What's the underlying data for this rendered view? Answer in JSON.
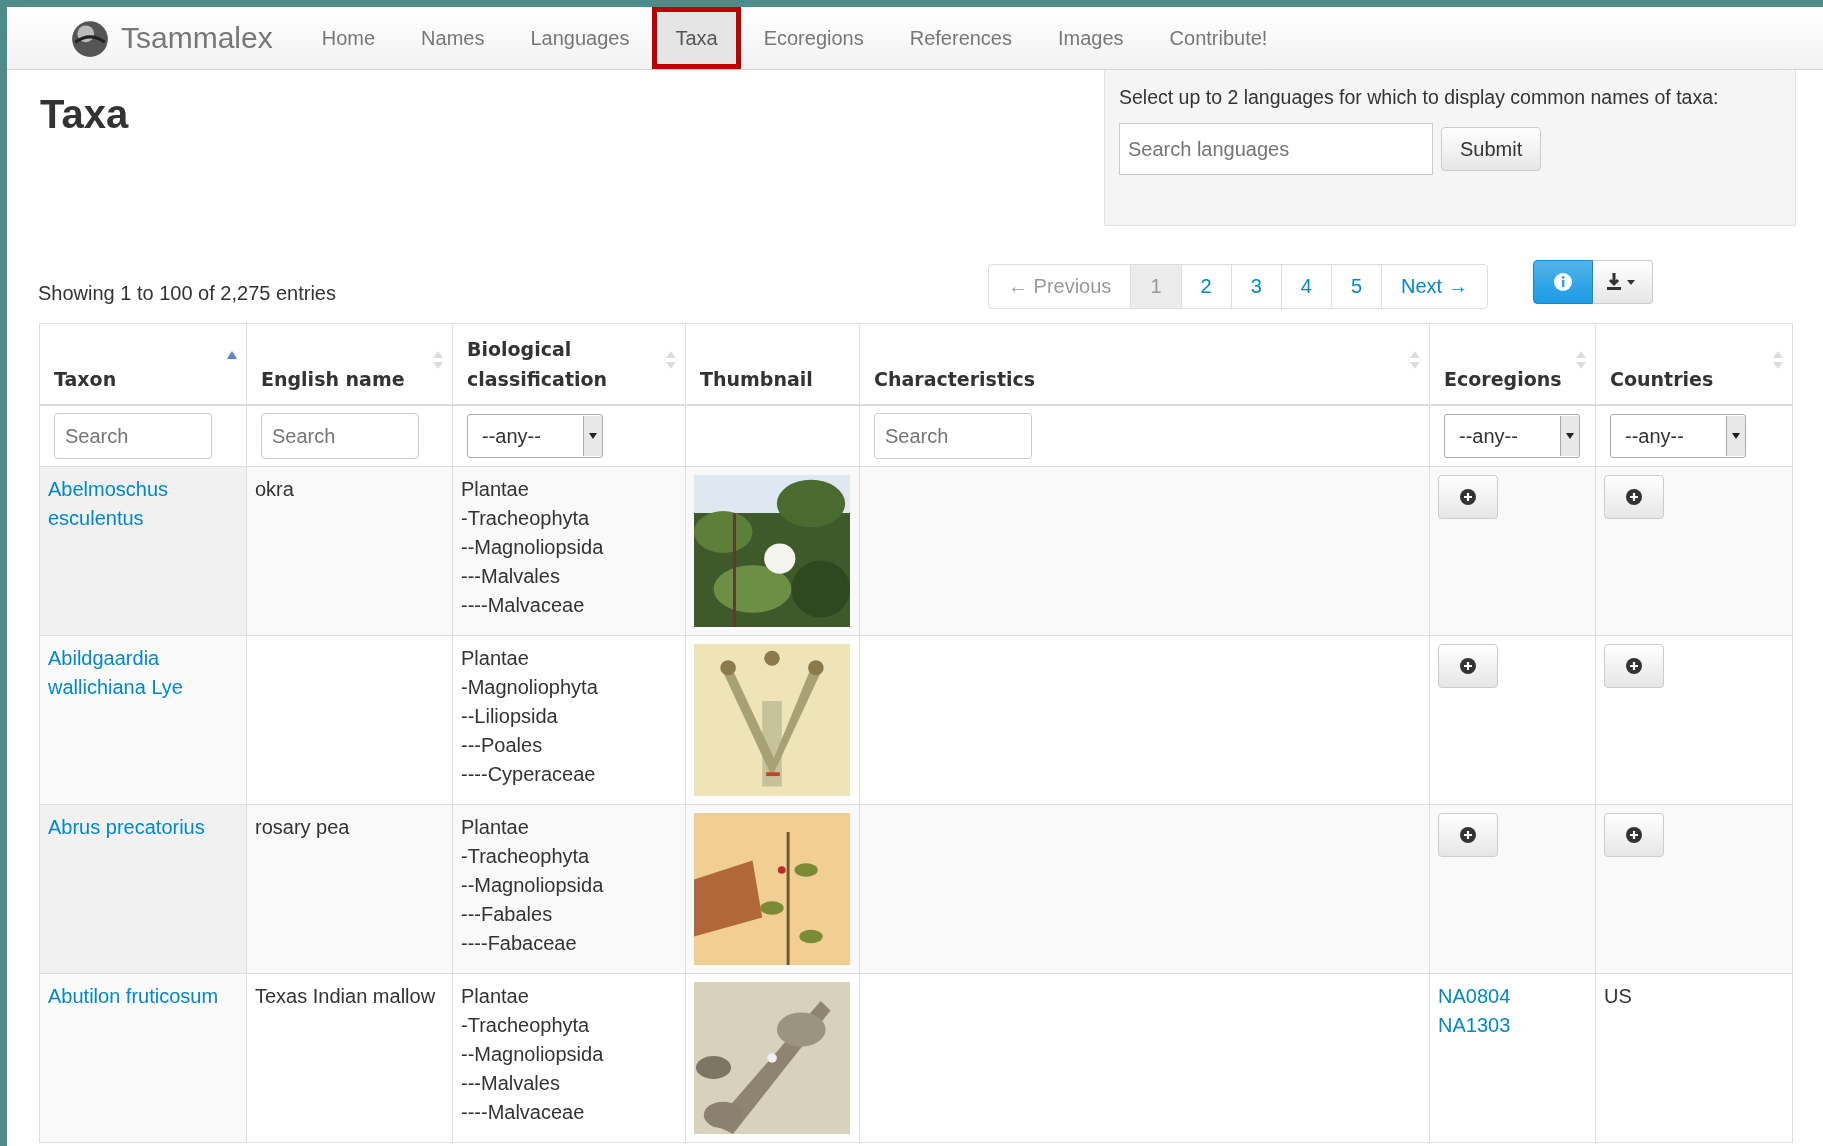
{
  "brand": "Tsammalex",
  "nav": [
    {
      "label": "Home",
      "selected": false
    },
    {
      "label": "Names",
      "selected": false
    },
    {
      "label": "Languages",
      "selected": false
    },
    {
      "label": "Taxa",
      "selected": true
    },
    {
      "label": "Ecoregions",
      "selected": false
    },
    {
      "label": "References",
      "selected": false
    },
    {
      "label": "Images",
      "selected": false
    },
    {
      "label": "Contribute!",
      "selected": false
    }
  ],
  "title": "Taxa",
  "language_panel": {
    "text": "Select up to 2 languages for which to display common names of taxa:",
    "placeholder": "Search languages",
    "button": "Submit"
  },
  "info": "Showing 1 to 100 of 2,275 entries",
  "pagination": [
    {
      "label": "← Previous",
      "selected": false,
      "disabled": true
    },
    {
      "label": "1",
      "selected": true,
      "disabled": false
    },
    {
      "label": "2",
      "selected": false,
      "disabled": false
    },
    {
      "label": "3",
      "selected": false,
      "disabled": false
    },
    {
      "label": "4",
      "selected": false,
      "disabled": false
    },
    {
      "label": "5",
      "selected": false,
      "disabled": false
    },
    {
      "label": "Next →",
      "selected": false,
      "disabled": false
    }
  ],
  "columns": [
    {
      "label": "Taxon",
      "sorted": true,
      "filter": {
        "kind": "search",
        "placeholder": "Search"
      }
    },
    {
      "label": "English name",
      "sorted": false,
      "filter": {
        "kind": "search",
        "placeholder": "Search"
      }
    },
    {
      "label": "Biological classification",
      "sorted": false,
      "filter": {
        "kind": "select",
        "value": "--any--"
      }
    },
    {
      "label": "Thumbnail"
    },
    {
      "label": "Characteristics",
      "sorted": false,
      "filter": {
        "kind": "search",
        "placeholder": "Search"
      }
    },
    {
      "label": "Ecoregions",
      "sorted": false,
      "filter": {
        "kind": "select",
        "value": "--any--"
      }
    },
    {
      "label": "Countries",
      "sorted": false,
      "filter": {
        "kind": "select",
        "value": "--any--"
      }
    }
  ],
  "rows": [
    {
      "taxon": "Abelmoschus esculentus",
      "english": "okra",
      "classification": [
        "Plantae",
        "-Tracheophyta",
        "--Magnoliopsida",
        "---Malvales",
        "----Malvaceae"
      ],
      "ecoregions": {
        "kind": "toggle"
      },
      "countries": {
        "kind": "toggle"
      }
    },
    {
      "taxon": "Abildgaardia wallichiana Lye",
      "classification": [
        "Plantae",
        "-Magnoliophyta",
        "--Liliopsida",
        "---Poales",
        "----Cyperaceae"
      ],
      "ecoregions": {
        "kind": "toggle"
      },
      "countries": {
        "kind": "toggle"
      }
    },
    {
      "taxon": "Abrus precatorius",
      "english": "rosary pea",
      "classification": [
        "Plantae",
        "-Tracheophyta",
        "--Magnoliopsida",
        "---Fabales",
        "----Fabaceae"
      ],
      "ecoregions": {
        "kind": "toggle"
      },
      "countries": {
        "kind": "toggle"
      }
    },
    {
      "taxon": "Abutilon fruticosum",
      "english": "Texas Indian mallow",
      "classification": [
        "Plantae",
        "-Tracheophyta",
        "--Magnoliopsida",
        "---Malvales",
        "----Malvaceae"
      ],
      "ecoregions": {
        "kind": "list",
        "items": [
          "NA0804",
          "NA1303"
        ]
      },
      "countries": {
        "kind": "text",
        "text": "US"
      }
    }
  ]
}
